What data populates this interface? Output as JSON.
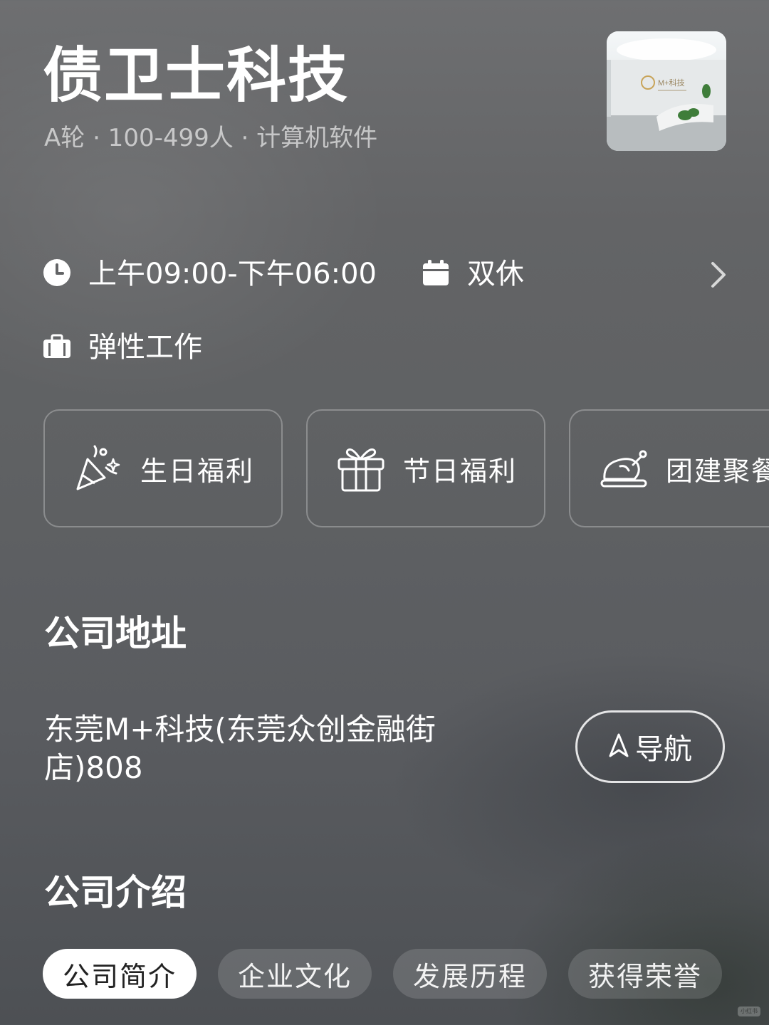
{
  "company": {
    "name": "债卫士科技",
    "meta": "A轮 · 100-499人 · 计算机软件",
    "photo_sign": "M+科技"
  },
  "work_info": {
    "hours": "上午09:00-下午06:00",
    "rest": "双休",
    "flex": "弹性工作",
    "icons": {
      "hours": "clock-icon",
      "rest": "calendar-icon",
      "flex": "briefcase-icon",
      "more": "chevron-right-icon"
    }
  },
  "benefits": [
    {
      "label": "生日福利",
      "icon": "party-popper-icon"
    },
    {
      "label": "节日福利",
      "icon": "gift-icon"
    },
    {
      "label": "团建聚餐",
      "icon": "roast-chicken-icon"
    }
  ],
  "address_section": {
    "title": "公司地址",
    "address": "东莞M+科技(东莞众创金融街店)808",
    "nav_label": "导航",
    "nav_icon": "navigation-arrow-icon"
  },
  "intro_section": {
    "title": "公司介绍",
    "tabs": [
      {
        "label": "公司简介",
        "active": true
      },
      {
        "label": "企业文化",
        "active": false
      },
      {
        "label": "发展历程",
        "active": false
      },
      {
        "label": "获得荣誉",
        "active": false
      }
    ]
  },
  "watermark": "小红书"
}
